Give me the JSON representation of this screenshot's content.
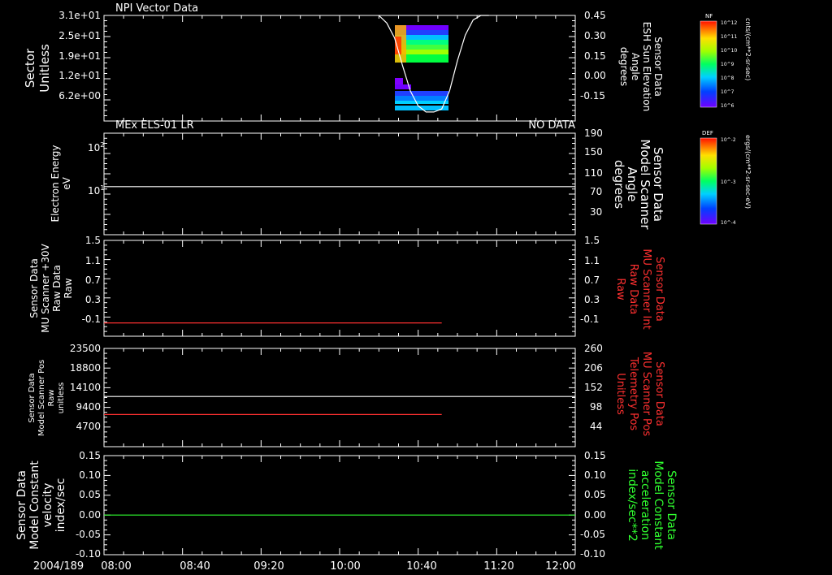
{
  "title": "NPI Vector Data",
  "date_label": "2004/189",
  "x_axis": {
    "start": "08:00",
    "end": "12:00",
    "ticks": [
      "08:00",
      "08:40",
      "09:20",
      "10:00",
      "10:40",
      "11:20",
      "12:00"
    ]
  },
  "colors": {
    "red": "#ff3030",
    "green": "#30ff30",
    "white": "#ffffff"
  },
  "panels": [
    {
      "id": "p1",
      "left_label": [
        "Sector",
        "Unitless"
      ],
      "left_ticks": [
        "3.1e+01",
        "2.5e+01",
        "1.9e+01",
        "1.2e+01",
        "6.2e+00"
      ],
      "right_ticks": [
        "0.45",
        "0.30",
        "0.15",
        "0.00",
        "-0.15"
      ],
      "right_label": [
        "Sensor Data",
        "ESH Sun Elevation",
        "Angle",
        "degrees"
      ],
      "right_label_color": "#ffffff"
    },
    {
      "id": "p2",
      "top_left": "MEx ELS-01 LR",
      "top_right": "NO DATA",
      "left_label": [
        "Electron Energy",
        "eV"
      ],
      "left_ticks": [
        "10^2",
        "10^1"
      ],
      "right_ticks": [
        "190",
        "150",
        "110",
        "70",
        "30"
      ],
      "right_label": [
        "Sensor Data",
        "Model Scanner",
        "Angle",
        "degrees"
      ],
      "right_label_color": "#ffffff"
    },
    {
      "id": "p3",
      "left_label": [
        "Sensor Data",
        "MU Scanner +30V",
        "Raw Data",
        "Raw"
      ],
      "left_ticks": [
        "1.5",
        "1.1",
        "0.7",
        "0.3",
        "-0.1"
      ],
      "right_ticks": [
        "1.5",
        "1.1",
        "0.7",
        "0.3",
        "-0.1"
      ],
      "right_label": [
        "Sensor Data",
        "MU Scanner Int",
        "Raw Data",
        "Raw"
      ],
      "right_label_color": "#ff3030"
    },
    {
      "id": "p4",
      "left_label": [
        "Sensor Data",
        "Model Scanner Pos",
        "Raw",
        "unitless"
      ],
      "left_ticks": [
        "23500",
        "18800",
        "14100",
        "9400",
        "4700"
      ],
      "right_ticks": [
        "260",
        "206",
        "152",
        "98",
        "44"
      ],
      "right_label": [
        "Sensor Data",
        "MU Scanner Pos",
        "Telemetry Pos",
        "Unitless"
      ],
      "right_label_color": "#ff3030"
    },
    {
      "id": "p5",
      "left_label": [
        "Sensor Data",
        "Model Constant",
        "velocity",
        "index/sec"
      ],
      "left_ticks": [
        "0.15",
        "0.10",
        "0.05",
        "0.00",
        "-0.05",
        "-0.10"
      ],
      "right_ticks": [
        "0.15",
        "0.10",
        "0.05",
        "0.00",
        "-0.05",
        "-0.10"
      ],
      "right_label": [
        "Sensor Data",
        "Model Constant",
        "acceleration",
        "index/sec**2"
      ],
      "right_label_color": "#30ff30"
    }
  ],
  "colorbars": [
    {
      "label": "NF",
      "unit": "cnts/(cm**2-sr-sec)",
      "ticks": [
        "10^12",
        "10^11",
        "10^10",
        "10^9",
        "10^8",
        "10^7",
        "10^6"
      ]
    },
    {
      "label": "DEF",
      "unit": "ergs/(cm**2-sr-sec-eV)",
      "ticks": [
        "10^-2",
        "10^-3",
        "10^-4"
      ]
    }
  ],
  "chart_data": [
    {
      "type": "line",
      "panel": "p1",
      "name": "Sun Elevation Angle",
      "x": [
        "10:20",
        "10:24",
        "10:28",
        "10:32",
        "10:36",
        "10:40",
        "10:44",
        "10:48",
        "10:52",
        "10:56",
        "11:00",
        "11:04",
        "11:08",
        "11:12",
        "11:16"
      ],
      "y": [
        0.45,
        0.4,
        0.3,
        0.12,
        -0.05,
        -0.15,
        -0.19,
        -0.19,
        -0.17,
        -0.05,
        0.15,
        0.32,
        0.42,
        0.45,
        0.45
      ],
      "ylim": [
        -0.25,
        0.45
      ]
    },
    {
      "type": "heatmap",
      "panel": "p1",
      "name": "NPI sectors",
      "x_range": [
        "10:20",
        "10:52"
      ],
      "note": "color-coded sector spectrogram"
    },
    {
      "type": "line",
      "panel": "p2",
      "name": "Model Scanner Angle",
      "x": [
        "08:00",
        "12:00"
      ],
      "y": [
        90,
        90
      ],
      "ylim": [
        0,
        190
      ]
    },
    {
      "type": "line",
      "panel": "p3",
      "name": "MU Scanner Int",
      "x": [
        "08:00",
        "10:52"
      ],
      "y": [
        -0.05,
        -0.05
      ],
      "ylim": [
        -0.3,
        1.5
      ]
    },
    {
      "type": "line",
      "panel": "p4",
      "name": "Model Scanner Pos",
      "x": [
        "08:00",
        "12:00"
      ],
      "y": [
        12000,
        12000
      ],
      "ylim": [
        0,
        23500
      ]
    },
    {
      "type": "line",
      "panel": "p4",
      "name": "MU Scanner Pos Telemetry",
      "x": [
        "08:00",
        "10:52"
      ],
      "y": [
        85,
        85
      ],
      "ylim": [
        0,
        260
      ]
    },
    {
      "type": "line",
      "panel": "p5",
      "name": "Model Constant acceleration",
      "x": [
        "08:00",
        "12:00"
      ],
      "y": [
        0.0,
        0.0
      ],
      "ylim": [
        -0.1,
        0.15
      ]
    }
  ]
}
